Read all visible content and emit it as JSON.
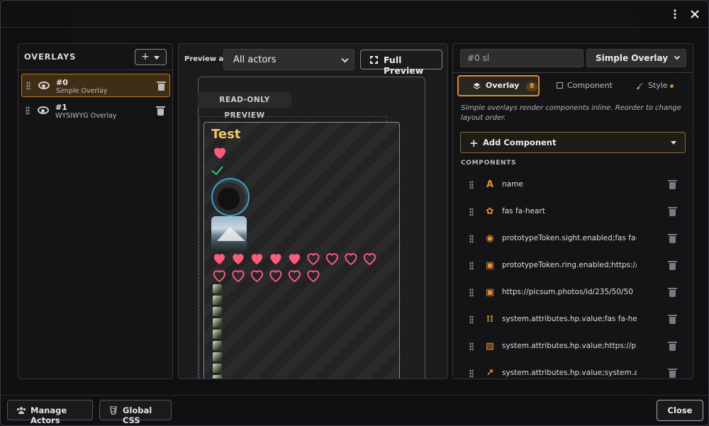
{
  "titlebar": {
    "menu_icon": "ellipsis-vertical-icon",
    "close_icon": "close-icon"
  },
  "overlays_panel": {
    "title": "OVERLAYS",
    "add_label": "+",
    "items": [
      {
        "id": "#0",
        "type": "Simple Overlay",
        "selected": true
      },
      {
        "id": "#1",
        "type": "WYSIWYG Overlay",
        "selected": false
      }
    ]
  },
  "preview": {
    "preview_as_label": "Preview as",
    "actor_select": "All actors",
    "full_preview_label": "Full Preview",
    "read_only_label": "READ-ONLY PREVIEW",
    "overlay_title": "Test",
    "hp": {
      "filled": 5,
      "total": 15
    }
  },
  "editor": {
    "name_value": "#0 sl",
    "type_value": "Simple Overlay",
    "tabs": [
      {
        "label": "Overlay",
        "badge": "8",
        "active": true
      },
      {
        "label": "Component",
        "active": false
      },
      {
        "label": "Style",
        "active": false,
        "dot": true
      }
    ],
    "hint": "Simple overlays render components inline. Reorder to change layout order.",
    "add_component_label": "Add Component",
    "components_title": "COMPONENTS",
    "components": [
      {
        "label": "name",
        "icon": "text-icon"
      },
      {
        "label": "fas fa-heart",
        "icon": "icons-icon"
      },
      {
        "label": "prototypeToken.sight.enabled;fas fa-...",
        "icon": "toggle-icon"
      },
      {
        "label": "prototypeToken.ring.enabled;https://...",
        "icon": "image-icon"
      },
      {
        "label": "https://picsum.photos/id/235/50/50",
        "icon": "image-icon"
      },
      {
        "label": "system.attributes.hp.value;fas fa-he...",
        "icon": "grid-icon"
      },
      {
        "label": "system.attributes.hp.value;https://p...",
        "icon": "images-icon"
      },
      {
        "label": "system.attributes.hp.value;system.at...",
        "icon": "chart-icon"
      }
    ]
  },
  "footer": {
    "manage_actors_label": "Manage Actors",
    "global_css_label": "Global CSS",
    "close_label": "Close"
  },
  "colors": {
    "accent": "#e08a2a",
    "heart": "#ff5c7a",
    "check": "#2ecc71",
    "title": "#f4c56a"
  }
}
